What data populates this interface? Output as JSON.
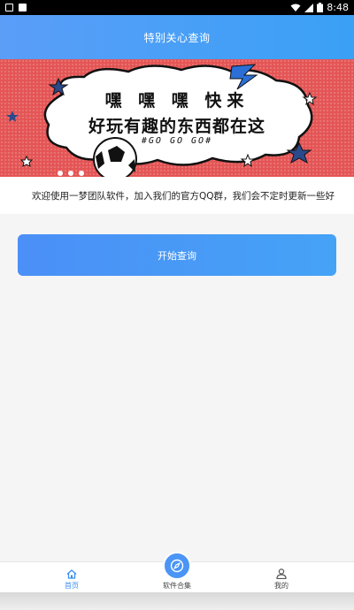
{
  "status_bar": {
    "time": "8:48"
  },
  "header": {
    "title": "特别关心查询"
  },
  "banner": {
    "line1": "嘿 嘿 嘿 快来",
    "line2": "好玩有趣的东西都在这",
    "line3": "#GO GO GO#"
  },
  "notice": {
    "text": "欢迎使用一梦团队软件，加入我们的官方QQ群，我们会不定时更新一些好"
  },
  "main": {
    "start_button": "开始查询"
  },
  "nav": {
    "items": [
      {
        "label": "首页",
        "icon": "home-icon",
        "active": true
      },
      {
        "label": "软件合集",
        "icon": "compass-icon",
        "active": false
      },
      {
        "label": "我的",
        "icon": "user-icon",
        "active": false
      }
    ]
  },
  "colors": {
    "accent": "#4a95f5",
    "banner": "#e45454"
  }
}
